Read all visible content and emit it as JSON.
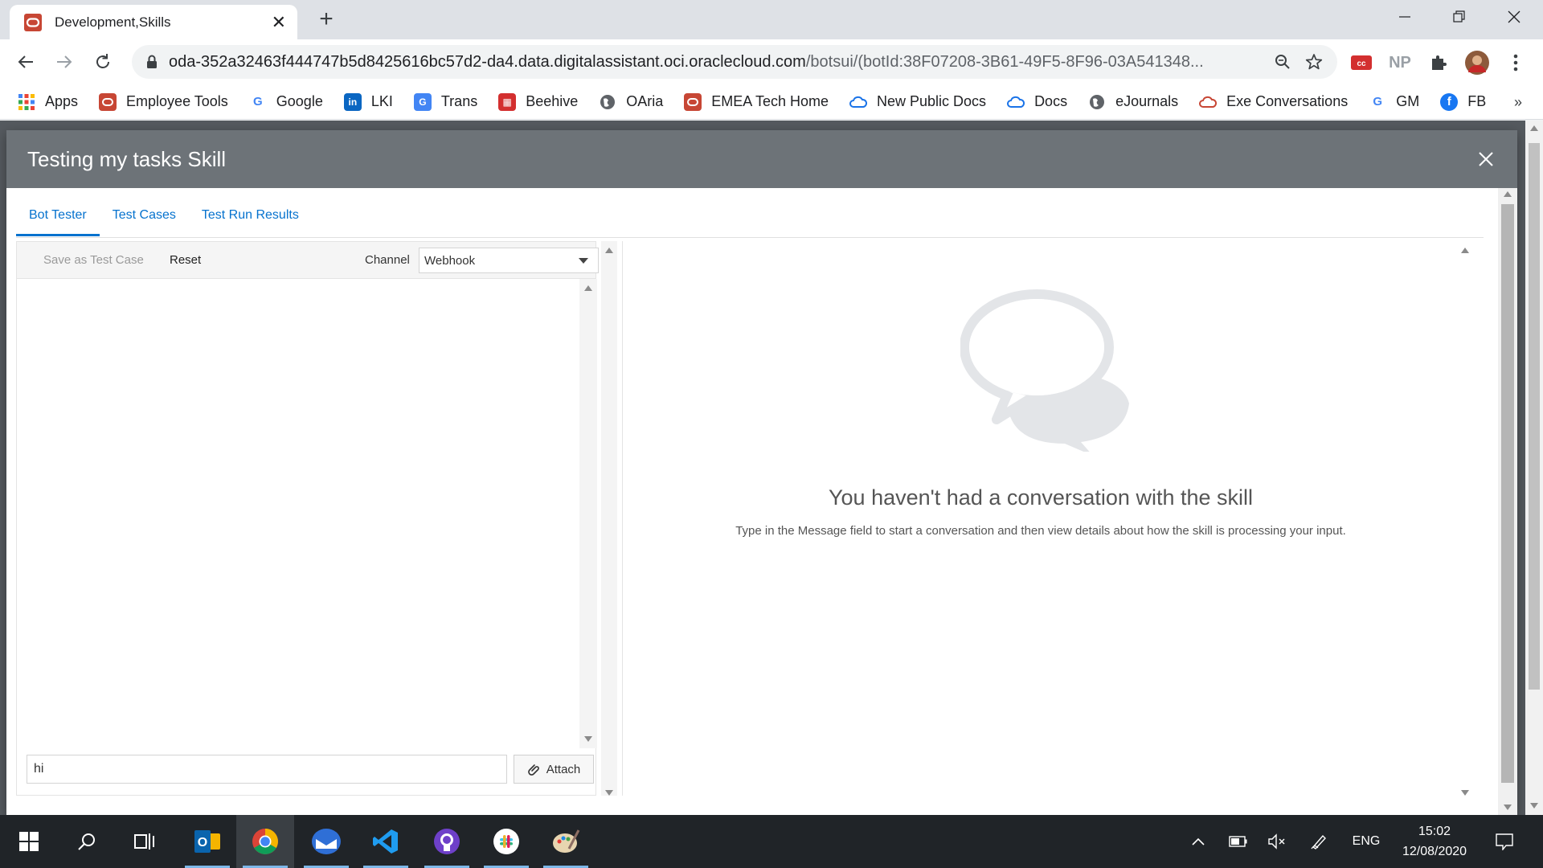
{
  "browser": {
    "tab_title": "Development,Skills",
    "url_host": "oda-352a32463f444747b5d8425616bc57d2-da4.data.digitalassistant.oci.oraclecloud.com",
    "url_path": "/botsui/(botId:38F07208-3B61-49F5-8F96-03A541348...",
    "extensions": [
      "cc-extension-icon",
      "np-extension-icon",
      "puzzle-icon",
      "profile-avatar"
    ],
    "np_label": "NP"
  },
  "bookmarks": [
    {
      "label": "Apps",
      "icon": "apps-grid-icon"
    },
    {
      "label": "Employee Tools",
      "icon": "oracle-icon"
    },
    {
      "label": "Google",
      "icon": "google-icon"
    },
    {
      "label": "LKI",
      "icon": "linkedin-icon"
    },
    {
      "label": "Trans",
      "icon": "translate-icon"
    },
    {
      "label": "Beehive",
      "icon": "beehive-icon"
    },
    {
      "label": "OAria",
      "icon": "globe-icon"
    },
    {
      "label": "EMEA Tech Home",
      "icon": "oracle-icon"
    },
    {
      "label": "New Public Docs",
      "icon": "cloud-icon"
    },
    {
      "label": "Docs",
      "icon": "cloud-icon"
    },
    {
      "label": "eJournals",
      "icon": "globe-icon"
    },
    {
      "label": "Exe Conversations",
      "icon": "cloud-icon"
    },
    {
      "label": "GM",
      "icon": "google-icon"
    },
    {
      "label": "FB",
      "icon": "facebook-icon"
    }
  ],
  "dialog": {
    "title": "Testing my tasks Skill",
    "tabs": [
      {
        "label": "Bot Tester",
        "active": true
      },
      {
        "label": "Test Cases",
        "active": false
      },
      {
        "label": "Test Run Results",
        "active": false
      }
    ],
    "toolbar": {
      "save_label": "Save as Test Case",
      "reset_label": "Reset",
      "channel_label": "Channel",
      "channel_value": "Webhook"
    },
    "message_input_value": "hi",
    "attach_label": "Attach",
    "empty_state": {
      "title": "You haven't had a conversation with the skill",
      "subtitle": "Type in the Message field to start a conversation and then view details about how the skill is processing your input."
    }
  },
  "taskbar": {
    "apps": [
      "outlook-icon",
      "chrome-icon",
      "mail-icon",
      "vscode-icon",
      "github-icon",
      "slack-icon",
      "paint-icon"
    ],
    "tray": {
      "language": "ENG",
      "time": "15:02",
      "date": "12/08/2020"
    }
  },
  "colors": {
    "accent": "#0572ce",
    "dialog_header": "#6d7378",
    "oracle_red": "#c74634"
  }
}
